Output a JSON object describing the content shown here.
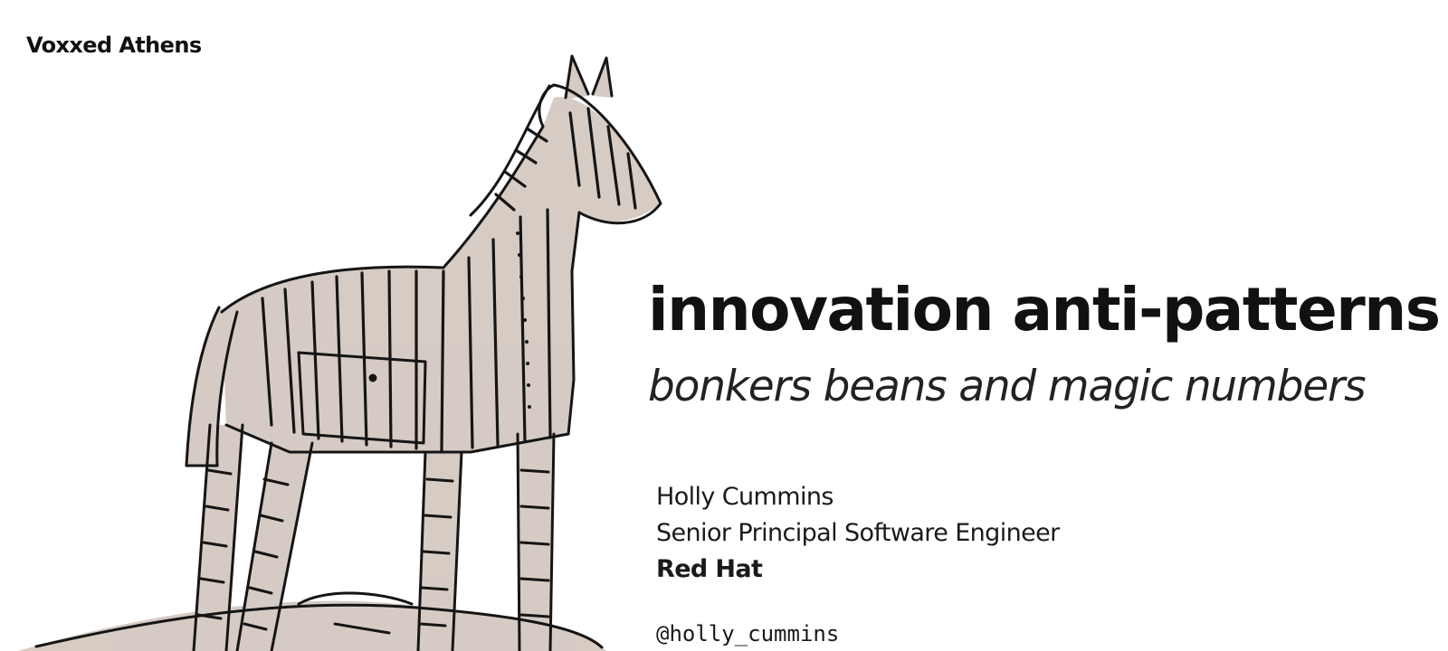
{
  "event": {
    "name": "Voxxed Athens"
  },
  "talk": {
    "title": "innovation anti-patterns",
    "subtitle": "bonkers beans and magic numbers"
  },
  "speaker": {
    "name": "Holly Cummins",
    "role": "Senior Principal Software Engineer",
    "company": "Red Hat",
    "handle": "@holly_cummins"
  },
  "illustration": {
    "subject": "striped-wooden-horse",
    "colors": {
      "outline": "#151515",
      "wash": "#cfc3ba"
    }
  }
}
